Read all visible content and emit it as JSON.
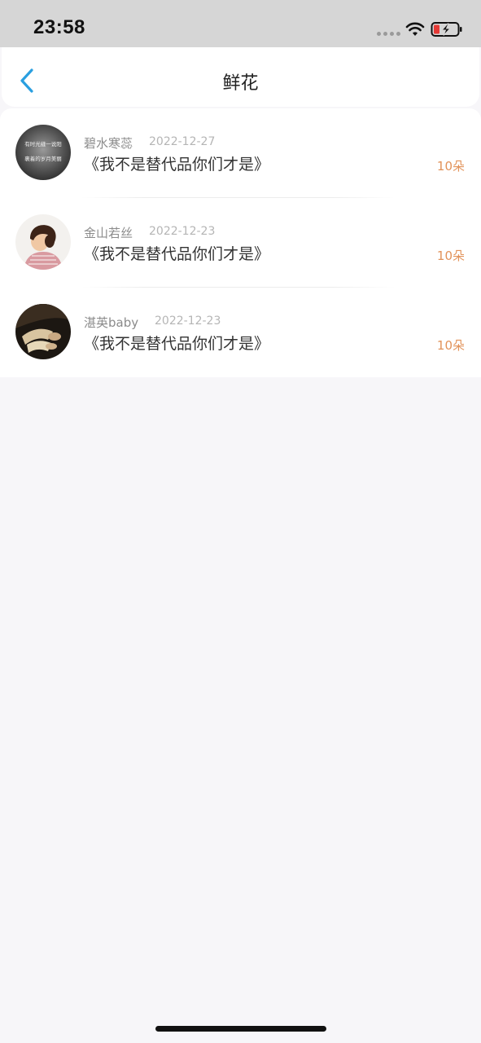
{
  "status_bar": {
    "time": "23:58"
  },
  "nav": {
    "title": "鲜花",
    "back_icon": "chevron-left-icon",
    "accent": "#2a9fe0"
  },
  "items": [
    {
      "name": "碧水寒蕊",
      "date": "2022-12-27",
      "title": "《我不是替代品你们才是》",
      "count": "10朵",
      "avatar_text": [
        "有时光缝一说阳",
        "裹着的岁月美丽"
      ]
    },
    {
      "name": "金山若丝",
      "date": "2022-12-23",
      "title": "《我不是替代品你们才是》",
      "count": "10朵"
    },
    {
      "name": "湛英baby",
      "date": "2022-12-23",
      "title": "《我不是替代品你们才是》",
      "count": "10朵"
    }
  ],
  "colors": {
    "count": "#e2935a",
    "name": "#8b8b8b",
    "date": "#b5b5b5",
    "background": "#f7f6f9"
  }
}
